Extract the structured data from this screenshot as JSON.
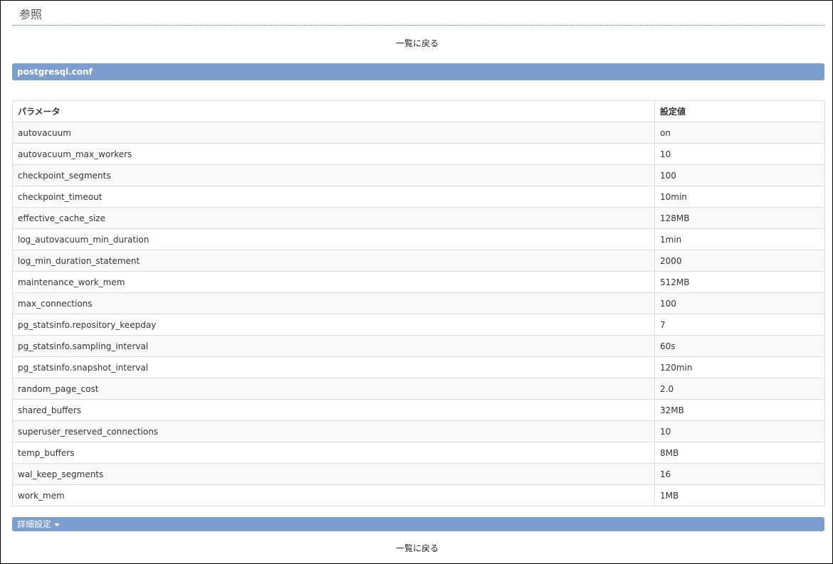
{
  "page": {
    "title": "参照",
    "back_link_label": "一覧に戻る"
  },
  "section": {
    "title": "postgresql.conf"
  },
  "table": {
    "headers": [
      "パラメータ",
      "設定値"
    ],
    "rows": [
      {
        "param": "autovacuum",
        "value": "on"
      },
      {
        "param": "autovacuum_max_workers",
        "value": "10"
      },
      {
        "param": "checkpoint_segments",
        "value": "100"
      },
      {
        "param": "checkpoint_timeout",
        "value": "10min"
      },
      {
        "param": "effective_cache_size",
        "value": "128MB"
      },
      {
        "param": "log_autovacuum_min_duration",
        "value": "1min"
      },
      {
        "param": "log_min_duration_statement",
        "value": "2000"
      },
      {
        "param": "maintenance_work_mem",
        "value": "512MB"
      },
      {
        "param": "max_connections",
        "value": "100"
      },
      {
        "param": "pg_statsinfo.repository_keepday",
        "value": "7"
      },
      {
        "param": "pg_statsinfo.sampling_interval",
        "value": "60s"
      },
      {
        "param": "pg_statsinfo.snapshot_interval",
        "value": "120min"
      },
      {
        "param": "random_page_cost",
        "value": "2.0"
      },
      {
        "param": "shared_buffers",
        "value": "32MB"
      },
      {
        "param": "superuser_reserved_connections",
        "value": "10"
      },
      {
        "param": "temp_buffers",
        "value": "8MB"
      },
      {
        "param": "wal_keep_segments",
        "value": "16"
      },
      {
        "param": "work_mem",
        "value": "1MB"
      }
    ]
  },
  "detail": {
    "label": "詳細設定"
  },
  "colors": {
    "section_bar": "#7b9ecf",
    "title_rule": "#2e7aa7"
  },
  "icons": {
    "detail_toggle": "caret-down-icon"
  }
}
